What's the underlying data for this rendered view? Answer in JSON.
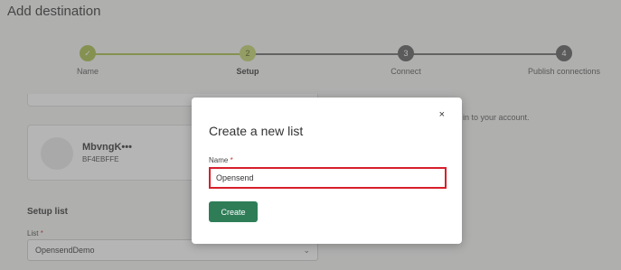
{
  "page": {
    "title": "Add destination",
    "helper_text": "in to your account."
  },
  "stepper": {
    "steps": [
      {
        "label": "Name",
        "marker": "✓",
        "state": "done"
      },
      {
        "label": "Setup",
        "marker": "2",
        "state": "current"
      },
      {
        "label": "Connect",
        "marker": "3",
        "state": "todo"
      },
      {
        "label": "Publish connections",
        "marker": "4",
        "state": "todo"
      }
    ]
  },
  "account": {
    "name": "MbvngK•••",
    "id": "BF4EBFFE"
  },
  "setup_list": {
    "heading": "Setup list",
    "list_label": "List",
    "required_mark": "*",
    "selected_value": "OpensendDemo",
    "chevron": "⌄"
  },
  "modal": {
    "title": "Create a new list",
    "close_glyph": "×",
    "field_label": "Name",
    "required_mark": "*",
    "name_value": "Opensend",
    "create_label": "Create"
  },
  "colors": {
    "accent_green": "#2e7d57",
    "step_done": "#a6be47",
    "step_current": "#c3d46c",
    "step_todo": "#5b5b5b",
    "error_border": "#d71f2b"
  }
}
